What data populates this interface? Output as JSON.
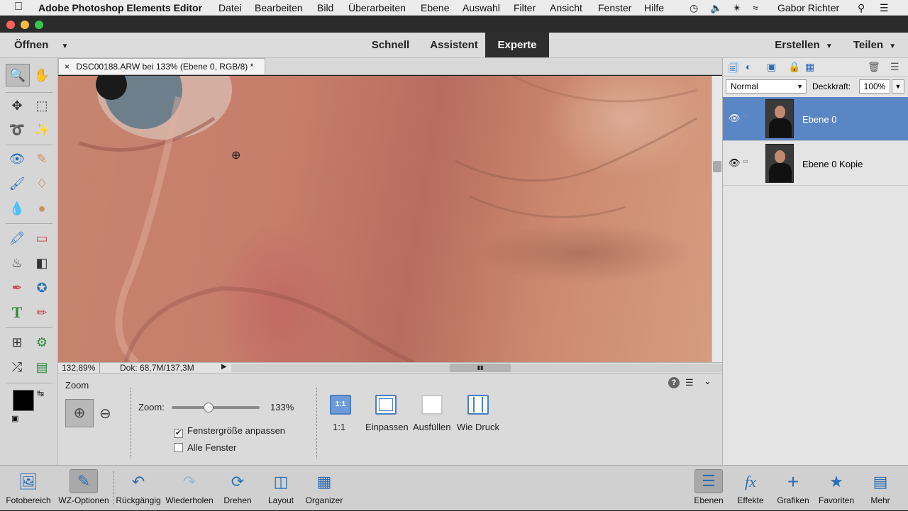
{
  "menubar": {
    "app_name": "Adobe Photoshop Elements Editor",
    "items": [
      "Datei",
      "Bearbeiten",
      "Bild",
      "Überarbeiten",
      "Ebene",
      "Auswahl",
      "Filter",
      "Ansicht",
      "Fenster",
      "Hilfe"
    ],
    "user": "Gabor Richter"
  },
  "modebar": {
    "open_label": "Öffnen",
    "modes": [
      "Schnell",
      "Assistent",
      "Experte"
    ],
    "active_mode": "Experte",
    "create_label": "Erstellen",
    "share_label": "Teilen"
  },
  "document": {
    "tab_close": "×",
    "tab_title": "DSC00188.ARW bei 133% (Ebene 0, RGB/8) *",
    "status_zoom": "132,89%",
    "status_doc": "Dok: 68,7M/137,3M"
  },
  "tool_options": {
    "title": "Zoom",
    "zoom_label": "Zoom:",
    "zoom_value": "133%",
    "zoom_fraction": 0.42,
    "resize_window_label": "Fenstergröße anpassen",
    "resize_window_checked": true,
    "all_windows_label": "Alle Fenster",
    "all_windows_checked": false,
    "view_buttons": [
      "1:1",
      "Einpassen",
      "Ausfüllen",
      "Wie Druck"
    ],
    "one_to_one_icon_text": "1:1"
  },
  "layers": {
    "blend_mode": "Normal",
    "opacity_label": "Deckkraft:",
    "opacity_value": "100%",
    "items": [
      {
        "name": "Ebene 0",
        "selected": true
      },
      {
        "name": "Ebene 0 Kopie",
        "selected": false
      }
    ]
  },
  "bottombar": {
    "left": [
      "Fotobereich",
      "WZ-Optionen",
      "Rückgängig",
      "Wiederholen",
      "Drehen",
      "Layout",
      "Organizer"
    ],
    "right": [
      "Ebenen",
      "Effekte",
      "Grafiken",
      "Favoriten",
      "Mehr"
    ]
  },
  "colors": {
    "accent": "#4a7fc0",
    "selected_layer": "#5b86c5",
    "active_mode_bg": "#2e2e2e",
    "foreground_color": "#000000",
    "background_color": "#ffffff"
  }
}
